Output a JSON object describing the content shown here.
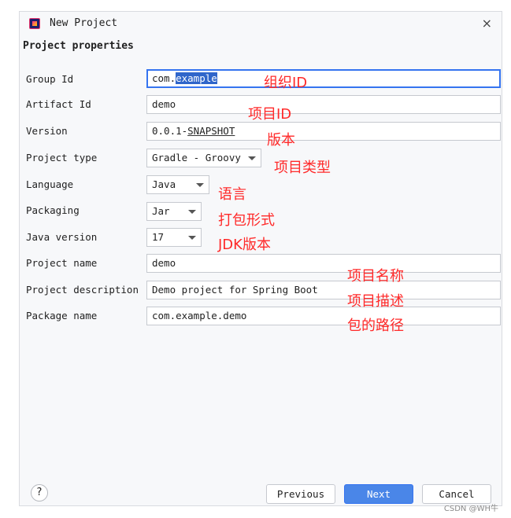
{
  "window": {
    "title": "New Project",
    "close_glyph": "×"
  },
  "section_title": "Project properties",
  "fields": {
    "group_id": {
      "label": "Group Id",
      "value_prefix": "com.",
      "value_selected": "example"
    },
    "artifact_id": {
      "label": "Artifact Id",
      "value": "demo"
    },
    "version": {
      "label": "Version",
      "value_prefix": "0.0.1-",
      "value_underlined": "SNAPSHOT"
    },
    "project_type": {
      "label": "Project type",
      "value": "Gradle - Groovy"
    },
    "language": {
      "label": "Language",
      "value": "Java"
    },
    "packaging": {
      "label": "Packaging",
      "value": "Jar"
    },
    "java_version": {
      "label": "Java version",
      "value": "17"
    },
    "project_name": {
      "label": "Project name",
      "value": "demo"
    },
    "project_description": {
      "label": "Project description",
      "value": "Demo project for Spring Boot"
    },
    "package_name": {
      "label": "Package name",
      "value": "com.example.demo"
    }
  },
  "annotations": {
    "group_id": "组织ID",
    "artifact_id": "项目ID",
    "version": "版本",
    "project_type": "项目类型",
    "language": "语言",
    "packaging": "打包形式",
    "java_version": "JDK版本",
    "project_name": "项目名称",
    "project_description": "项目描述",
    "package_name": "包的路径"
  },
  "footer": {
    "help": "?",
    "previous": "Previous",
    "next": "Next",
    "cancel": "Cancel"
  },
  "watermark": "CSDN @WH牛",
  "colors": {
    "accent": "#3574f0",
    "annotation": "#ff2a2a",
    "primary_button": "#4a86e8"
  }
}
